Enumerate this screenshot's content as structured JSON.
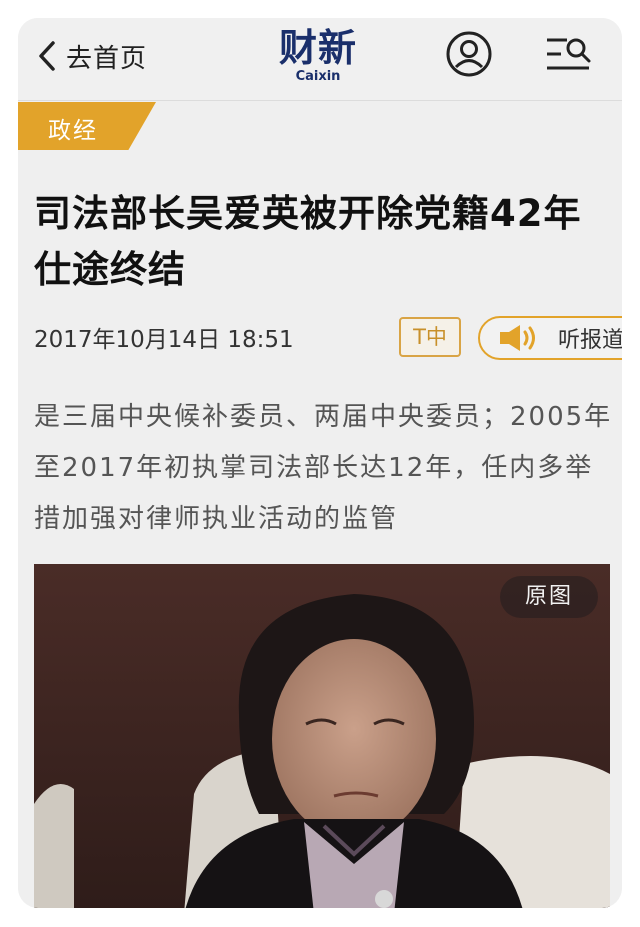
{
  "header": {
    "back_label": "去首页",
    "logo_cn": "财新",
    "logo_en": "Caixin",
    "user_icon": "user-circle-icon",
    "menu_icon": "menu-search-icon"
  },
  "category": {
    "label": "政经",
    "color": "#e2a32a"
  },
  "article": {
    "title": "司法部长吴爱英被开除党籍42年仕途终结",
    "datetime": "2017年10月14日 18:51",
    "font_size_button": "T中",
    "listen_button": "听报道",
    "summary": "是三届中央候补委员、两届中央委员；2005年至2017年初执掌司法部长达12年，任内多举措加强对律师执业活动的监管",
    "photo_button": "原图"
  },
  "colors": {
    "brand_navy": "#1a2f6b",
    "accent_orange": "#e2a32a"
  }
}
